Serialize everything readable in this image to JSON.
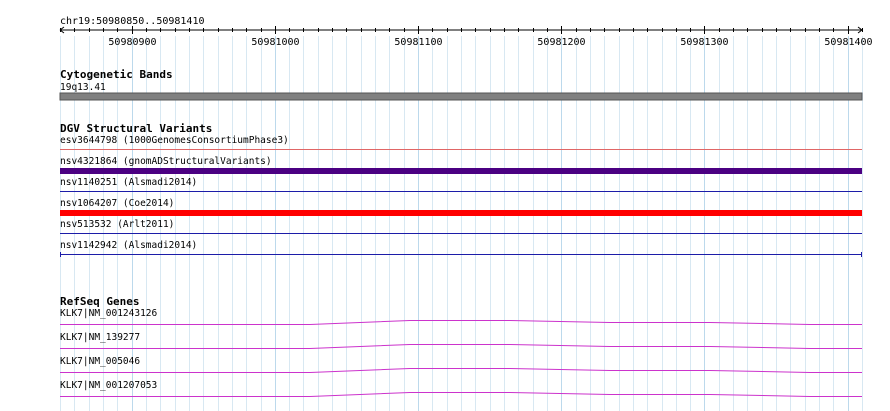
{
  "region": {
    "label": "chr19:50980850..50981410",
    "ticks": [
      {
        "label": "50980900",
        "pos": 50980900
      },
      {
        "label": "50981000",
        "pos": 50981000
      },
      {
        "label": "50981100",
        "pos": 50981100
      },
      {
        "label": "50981200",
        "pos": 50981200
      },
      {
        "label": "50981300",
        "pos": 50981300
      },
      {
        "label": "50981400",
        "pos": 50981400
      }
    ]
  },
  "tracks": {
    "cytogenetic": {
      "title": "Cytogenetic Bands",
      "band_label": "19q13.41",
      "band_color": "#808080"
    },
    "dgv": {
      "title": "DGV Structural Variants",
      "features": [
        {
          "label": "esv3644798 (1000GenomesConsortiumPhase3)",
          "color": "#e06666",
          "style": "thin"
        },
        {
          "label": "nsv4321864 (gnomADStructuralVariants)",
          "color": "#4b0082",
          "style": "thick"
        },
        {
          "label": "nsv1140251 (Alsmadi2014)",
          "color": "#1c1ca8",
          "style": "thin"
        },
        {
          "label": "nsv1064207 (Coe2014)",
          "color": "#ff0000",
          "style": "thick"
        },
        {
          "label": "nsv513532 (Arlt2011)",
          "color": "#1c1ca8",
          "style": "thin"
        },
        {
          "label": "nsv1142942 (Alsmadi2014)",
          "color": "#1c1ca8",
          "style": "thin-capped"
        }
      ]
    },
    "refseq": {
      "title": "RefSeq Genes",
      "color": "#cc33cc",
      "features": [
        {
          "label": "KLK7|NM_001243126"
        },
        {
          "label": "KLK7|NM_139277"
        },
        {
          "label": "KLK7|NM_005046"
        },
        {
          "label": "KLK7|NM_001207053"
        }
      ]
    }
  }
}
